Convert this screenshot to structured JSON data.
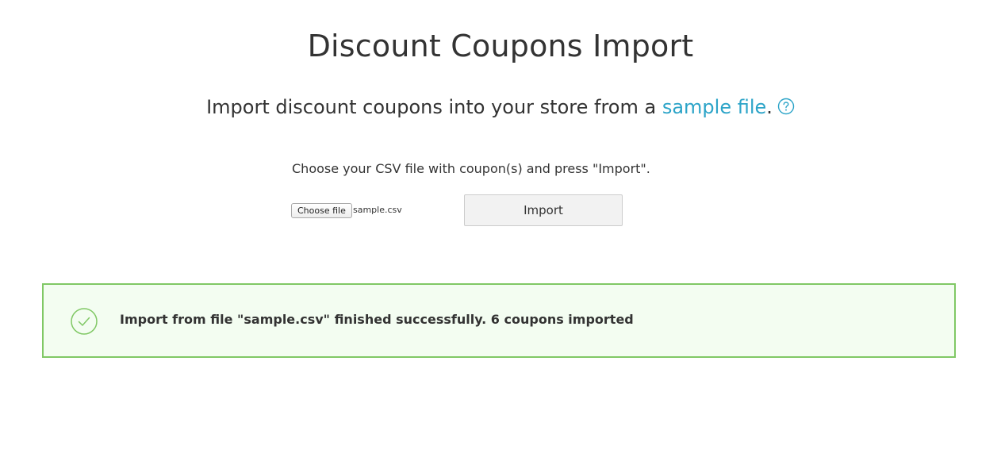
{
  "header": {
    "title": "Discount Coupons Import"
  },
  "intro": {
    "text_before": "Import discount coupons into your store from a ",
    "link_label": "sample file",
    "text_after": ".",
    "help_icon": "question-circle-icon"
  },
  "form": {
    "instruction": "Choose your CSV file with coupon(s) and press \"Import\".",
    "choose_file_label": "Choose file",
    "selected_file": "sample.csv",
    "import_label": "Import"
  },
  "notification": {
    "icon": "check-circle-icon",
    "message": "Import from file \"sample.csv\" finished successfully. 6 coupons imported"
  },
  "colors": {
    "link": "#2ca4c8",
    "success_border": "#80c865",
    "success_background": "#f3fdf1",
    "text": "#333333"
  }
}
